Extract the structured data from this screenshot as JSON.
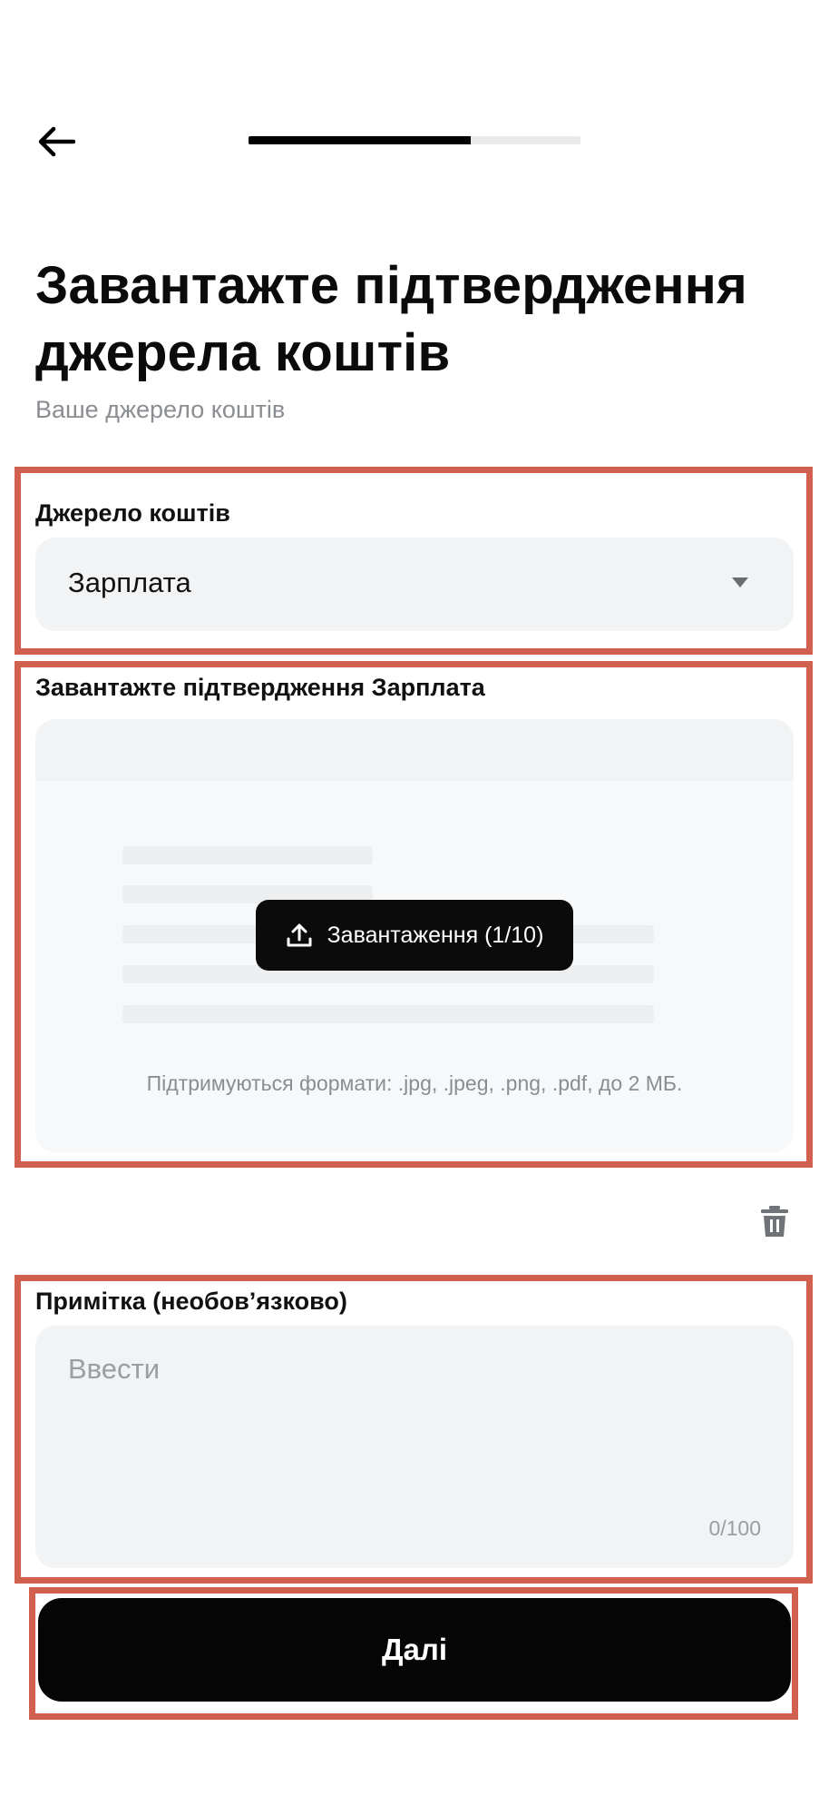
{
  "header": {
    "back_icon": "arrow-left-icon",
    "progress": 0.67
  },
  "title": "Завантажте підтвердження джерела коштів",
  "subtitle": "Ваше джерело коштів",
  "source_field": {
    "label": "Джерело коштів",
    "value": "Зарплата",
    "caret_icon": "caret-down-icon"
  },
  "upload": {
    "label": "Завантажте підтвердження Зарплата",
    "button_icon": "upload-icon",
    "button_label": "Завантаження (1/10)",
    "formats_hint": "Підтримуються формати: .jpg, .jpeg, .png, .pdf, до 2 МБ.",
    "delete_icon": "trash-icon"
  },
  "note": {
    "label": "Примітка (необов’язково)",
    "placeholder": "Ввести",
    "counter": "0/100"
  },
  "next_button": {
    "label": "Далі"
  },
  "colors": {
    "accent": "#000000",
    "field_bg": "#f1f3f5",
    "annotation_frame": "#d2604e"
  }
}
